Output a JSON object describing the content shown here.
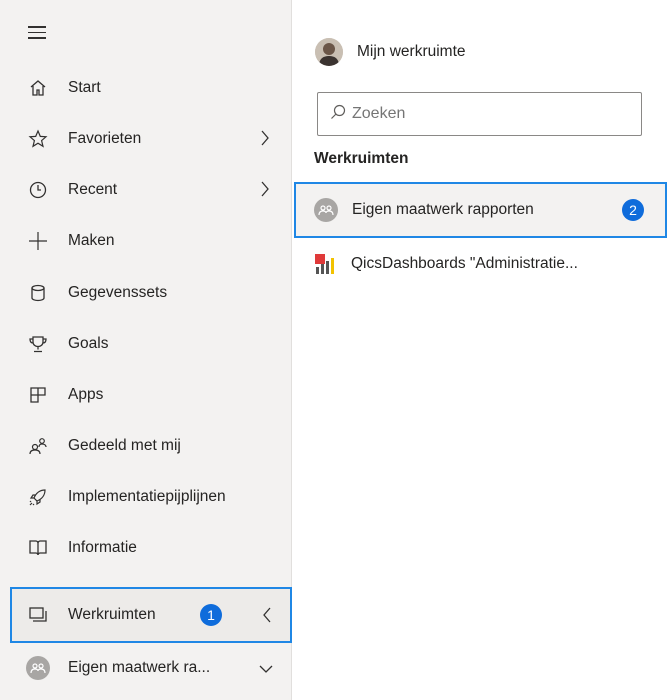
{
  "sidebar": {
    "items": [
      {
        "label": "Start",
        "icon": "home-icon"
      },
      {
        "label": "Favorieten",
        "icon": "star-icon"
      },
      {
        "label": "Recent",
        "icon": "clock-icon"
      },
      {
        "label": "Maken",
        "icon": "plus-icon"
      },
      {
        "label": "Gegevenssets",
        "icon": "database-icon"
      },
      {
        "label": "Goals",
        "icon": "trophy-icon"
      },
      {
        "label": "Apps",
        "icon": "apps-icon"
      },
      {
        "label": "Gedeeld met mij",
        "icon": "shared-people-icon"
      },
      {
        "label": "Implementatiepijplijnen",
        "icon": "rocket-icon"
      },
      {
        "label": "Informatie",
        "icon": "book-icon"
      }
    ],
    "workspaces": {
      "label": "Werkruimten",
      "badge": "1"
    },
    "current_workspace": {
      "label": "Eigen maatwerk ra..."
    }
  },
  "panel": {
    "my_workspace": "Mijn werkruimte",
    "search_placeholder": "Zoeken",
    "section_title": "Werkruimten",
    "workspaces": [
      {
        "label": "Eigen maatwerk rapporten",
        "badge": "2"
      },
      {
        "label": "QicsDashboards \"Administratie..."
      }
    ]
  },
  "colors": {
    "accent": "#1f87e5",
    "badge": "#0f6cdb",
    "sidebar_bg": "#f3f2f1"
  }
}
